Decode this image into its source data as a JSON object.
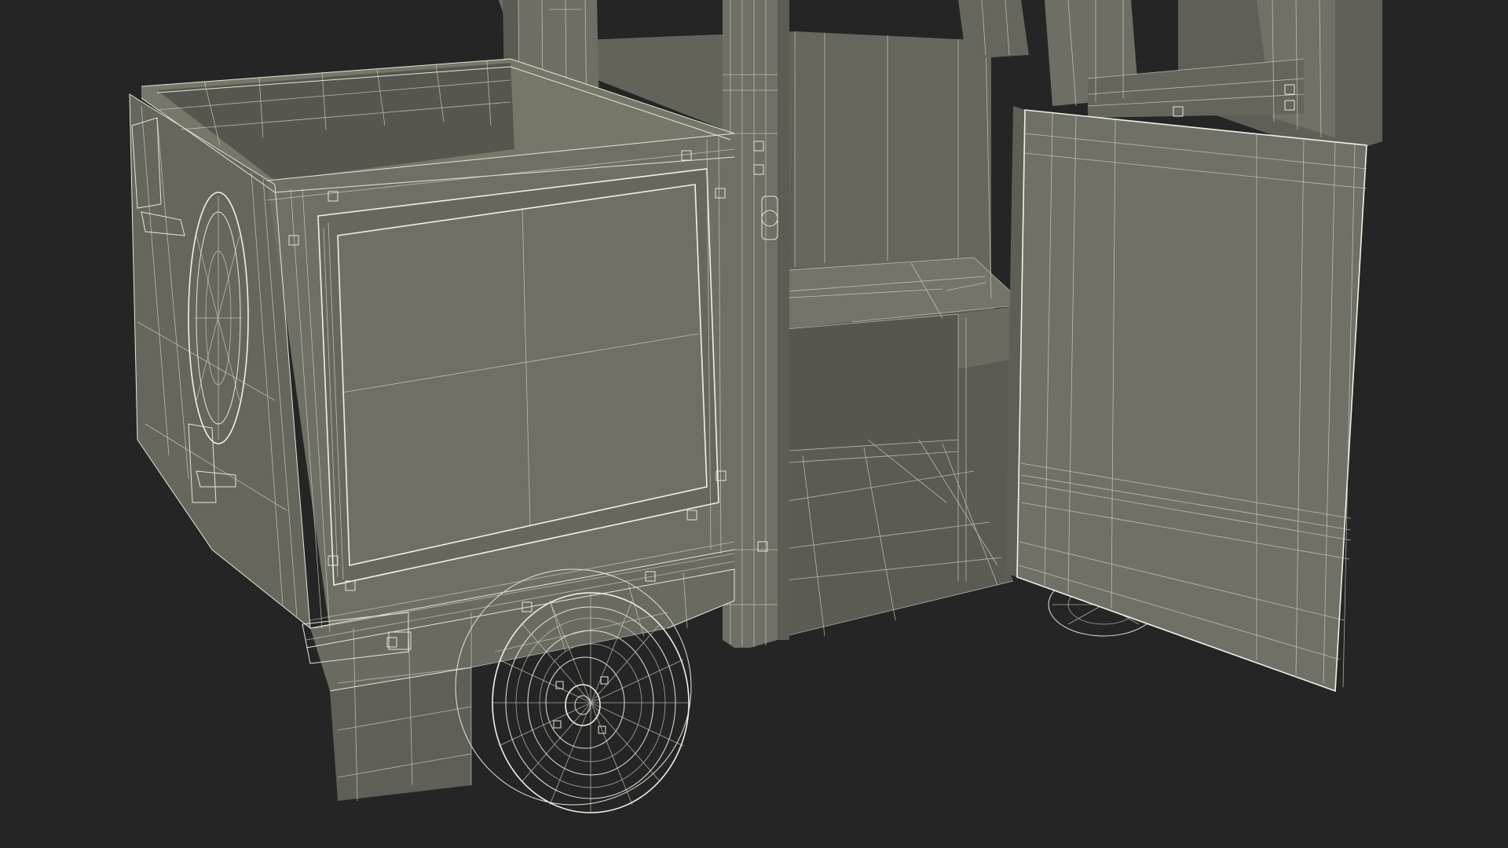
{
  "scene": {
    "background_color": "#252525",
    "surface_color": "#6c6c63",
    "surface_dark_color": "#4d4d46",
    "interior_color": "#5b5b53",
    "wire_color": "#e6e6da"
  }
}
